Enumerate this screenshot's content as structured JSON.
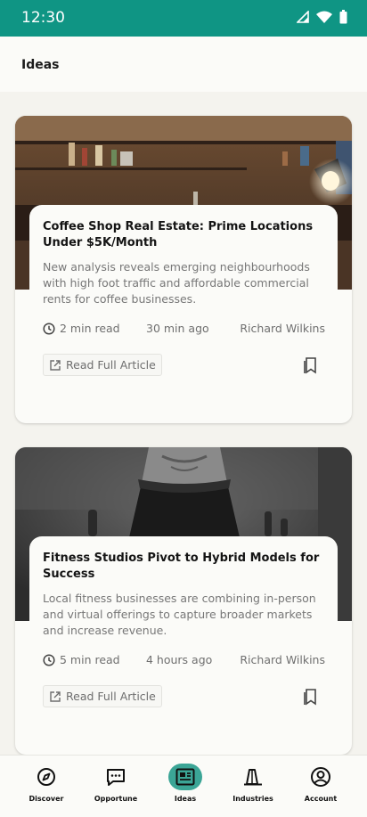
{
  "status_bar": {
    "time": "12:30",
    "icons": [
      "signal-icon",
      "wifi-icon",
      "battery-icon"
    ]
  },
  "header": {
    "title": "Ideas"
  },
  "articles": [
    {
      "title": "Coffee Shop Real Estate: Prime Locations Under $5K/Month",
      "description": "New analysis reveals emerging neighbourhoods with high foot traffic and affordable commercial rents for coffee businesses.",
      "read_time": "2 min read",
      "posted": "30 min ago",
      "author": "Richard Wilkins",
      "cta": "Read Full Article"
    },
    {
      "title": "Fitness Studios Pivot to Hybrid Models for Success",
      "description": "Local fitness businesses are combining in-person and virtual offerings to capture broader markets and increase revenue.",
      "read_time": "5 min read",
      "posted": "4 hours ago",
      "author": "Richard Wilkins",
      "cta": "Read Full Article"
    }
  ],
  "nav": {
    "active": "Ideas",
    "items": [
      {
        "label": "Discover",
        "icon": "compass-icon"
      },
      {
        "label": "Opportune",
        "icon": "chat-bubble-icon"
      },
      {
        "label": "Ideas",
        "icon": "newspaper-icon"
      },
      {
        "label": "Industries",
        "icon": "tower-icon"
      },
      {
        "label": "Account",
        "icon": "user-circle-icon"
      }
    ]
  },
  "colors": {
    "brand": "#0f9584",
    "nav_active": "#3ba596",
    "background": "#f4f3ee",
    "card": "#fbfbf8"
  }
}
